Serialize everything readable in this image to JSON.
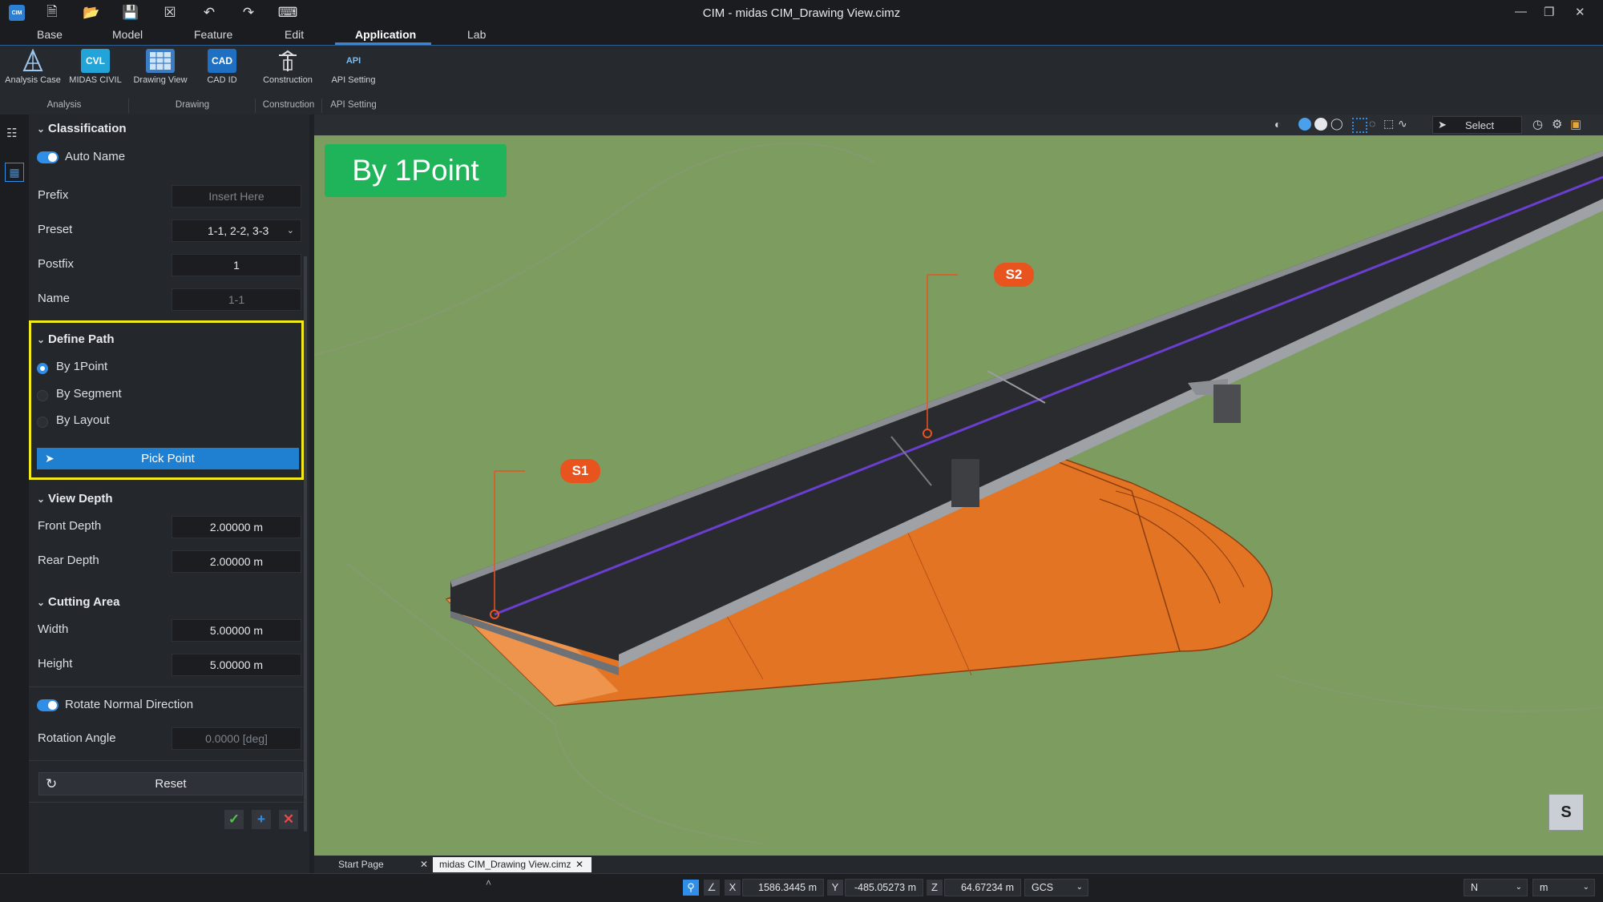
{
  "window": {
    "title": "CIM - midas CIM_Drawing View.cimz",
    "logo_text": "CIM"
  },
  "menu": {
    "tabs": [
      "Base",
      "Model",
      "Feature",
      "Edit",
      "Application",
      "Lab"
    ],
    "active": "Application"
  },
  "ribbon": {
    "buttons": [
      {
        "label": "Analysis Case",
        "icon": "analysis-case-icon"
      },
      {
        "label": "MIDAS CIVIL",
        "icon": "midas-civil-icon",
        "icon_text": "CVL"
      },
      {
        "label": "Drawing View",
        "icon": "drawing-view-icon"
      },
      {
        "label": "CAD ID",
        "icon": "cad-id-icon",
        "icon_text": "CAD"
      },
      {
        "label": "Construction",
        "icon": "construction-icon"
      },
      {
        "label": "API Setting",
        "icon": "api-setting-icon",
        "icon_text": "API"
      }
    ],
    "groups": [
      "Analysis",
      "Drawing",
      "Construction",
      "API Setting"
    ]
  },
  "panel": {
    "classification": {
      "header": "Classification",
      "auto_name": "Auto Name",
      "prefix_label": "Prefix",
      "prefix_placeholder": "Insert Here",
      "preset_label": "Preset",
      "preset_value": "1-1, 2-2, 3-3",
      "postfix_label": "Postfix",
      "postfix_value": "1",
      "name_label": "Name",
      "name_value": "1-1"
    },
    "define_path": {
      "header": "Define Path",
      "options": [
        "By 1Point",
        "By Segment",
        "By Layout"
      ],
      "selected": "By 1Point",
      "pick_button": "Pick Point"
    },
    "view_depth": {
      "header": "View Depth",
      "front_label": "Front Depth",
      "front_value": "2.00000 m",
      "rear_label": "Rear Depth",
      "rear_value": "2.00000 m"
    },
    "cutting_area": {
      "header": "Cutting Area",
      "width_label": "Width",
      "width_value": "5.00000 m",
      "height_label": "Height",
      "height_value": "5.00000 m"
    },
    "rotate_normal": "Rotate Normal Direction",
    "rotation_label": "Rotation Angle",
    "rotation_value": "0.0000 [deg]",
    "reset_button": "Reset"
  },
  "viewport": {
    "mode_label": "By 1Point",
    "select_label": "Select",
    "tags": [
      "S1",
      "S2"
    ],
    "compass_letter": "S"
  },
  "doc_tabs": [
    "Start Page",
    "midas CIM_Drawing View.cimz"
  ],
  "status": {
    "x_label": "X",
    "x_value": "1586.3445 m",
    "y_label": "Y",
    "y_value": "-485.05273 m",
    "z_label": "Z",
    "z_value": "64.67234 m",
    "cs": "GCS",
    "north": "N",
    "unit": "m"
  },
  "colors": {
    "accent": "#2e8ee8",
    "highlight": "#f2ea1a",
    "tag": "#e8531e",
    "mode_badge": "#1fb45a",
    "terrain": "#7a9a5f",
    "embankment": "#e0701e"
  }
}
